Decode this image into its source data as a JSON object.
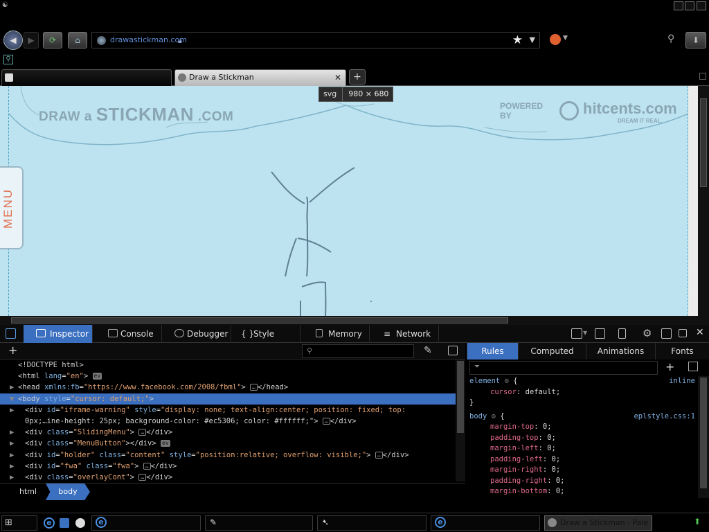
{
  "browser": {
    "url": "drawastickman.com",
    "tabs": [
      {
        "label": ""
      },
      {
        "label": "Draw a Stickman"
      }
    ],
    "new_tab_label": "+"
  },
  "page": {
    "size_tooltip_tag": "svg",
    "size_tooltip_dims": "980 × 680",
    "logo_left_prefix": "DRAW",
    "logo_left_a": "a",
    "logo_left_main": "STICKMAN",
    "logo_left_suffix": ".COM",
    "logo_right_powered": "POWERED BY",
    "logo_right_brand": "hitcents.com",
    "logo_right_tagline": "DREAM IT REAL.",
    "menu_label": "MENU"
  },
  "devtools": {
    "tabs": [
      "Inspector",
      "Console",
      "Debugger",
      "Style Editor",
      "Memory",
      "Network"
    ],
    "active_tab": "Inspector",
    "markup": [
      {
        "text": "<!DOCTYPE html>"
      },
      {
        "tag": "html",
        "attrs": " lang=\"en\"",
        "badge": "ev"
      },
      {
        "tag": "head",
        "attrs": " xmlns:fb=\"https://www.facebook.com/2008/fbml\"",
        "tail": "</head>",
        "ellipsis": true
      },
      {
        "tag": "body",
        "attrs": " style=\"cursor: default;\"",
        "selected": true
      },
      {
        "tag": "div",
        "attrs": " id=\"iframe-warning\" style=\"display: none; text-align:center; position: fixed; top:",
        "ellipsis": false
      },
      {
        "text": "0px;…ine-height: 25px; background-color: #ec5306; color: #ffffff;\">",
        "tail": "</div>",
        "ellipsis": true
      },
      {
        "tag": "div",
        "attrs": " class=\"SlidingMenu\"",
        "tail": "</div>",
        "ellipsis": true
      },
      {
        "tag": "div",
        "attrs": " class=\"MenuButton\"",
        "tail": "</div>",
        "badge": "ev"
      },
      {
        "tag": "div",
        "attrs": " id=\"holder\" class=\"content\" style=\"position:relative; overflow: visible;\"",
        "tail": "</div>",
        "ellipsis": true
      },
      {
        "tag": "div",
        "attrs": " id=\"fwa\" class=\"fwa\"",
        "tail": "</div>",
        "ellipsis": true
      },
      {
        "tag": "div",
        "attrs": " class=\"overlayCont\"",
        "tail": "</div>",
        "ellipsis": true
      }
    ],
    "breadcrumbs": [
      "html",
      "body"
    ],
    "side_tabs": [
      "Rules",
      "Computed",
      "Animations",
      "Fonts"
    ],
    "active_side_tab": "Rules",
    "rules": [
      {
        "selector": "element",
        "source": "inline",
        "props": [
          [
            "cursor",
            "default"
          ]
        ]
      },
      {
        "selector": "body",
        "source": "eplstyle.css:1",
        "props": [
          [
            "margin-top",
            "0"
          ],
          [
            "padding-top",
            "0"
          ],
          [
            "margin-left",
            "0"
          ],
          [
            "padding-left",
            "0"
          ],
          [
            "margin-right",
            "0"
          ],
          [
            "padding-right",
            "0"
          ],
          [
            "margin-bottom",
            "0"
          ]
        ]
      }
    ]
  },
  "taskbar": {
    "active_window": "Draw a Stickman - Pale Moon"
  }
}
